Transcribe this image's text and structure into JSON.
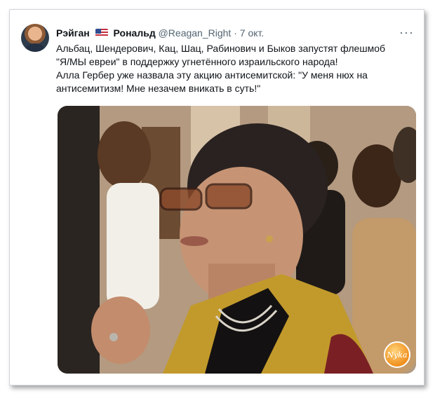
{
  "tweet": {
    "author_name_first": "Рэйган",
    "author_name_last": "Рональд",
    "handle": "@Reagan_Right",
    "separator": "·",
    "date": "7 окт.",
    "more_label": "···",
    "lines": [
      "Альбац, Шендерович, Кац, Шац, Рабинович и Быков запустят флешмоб",
      "\"Я/МЫ евреи\" в поддержку угнетённого израильского народа!",
      "Алла Гербер уже назвала эту акцию антисемитской: \"У меня нюх на",
      "антисемитизм! Мне незачем вникать в суть!\""
    ]
  },
  "watermark": {
    "text": "Nyka"
  },
  "colors": {
    "text": "#0f1419",
    "secondary": "#536471",
    "border": "#cfd5da"
  },
  "icons": {
    "flag": "us-flag-icon",
    "more": "more-options-icon"
  }
}
